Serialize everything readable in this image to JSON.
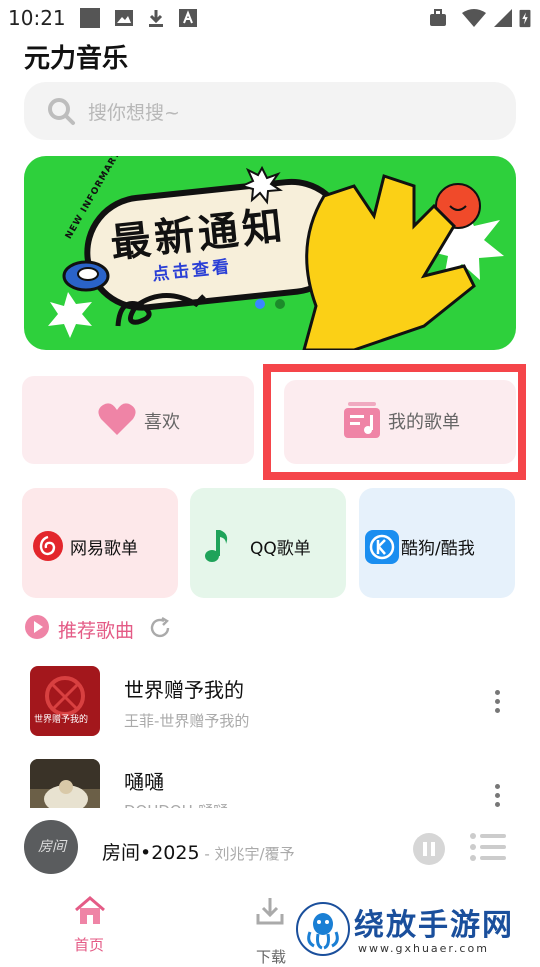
{
  "status_bar": {
    "time": "10:21"
  },
  "app_title": "元力音乐",
  "search": {
    "placeholder": "搜你想搜~"
  },
  "banner": {
    "tag": "NEW INFORMARTION",
    "heading": "最新通知",
    "subheading": "点击查看"
  },
  "quick_cards": {
    "favorites_label": "喜欢",
    "playlists_label": "我的歌单"
  },
  "sources": [
    {
      "label": "网易歌单"
    },
    {
      "label": "QQ歌单"
    },
    {
      "label": "酷狗/酷我"
    }
  ],
  "recommended": {
    "title": "推荐歌曲",
    "songs": [
      {
        "title": "世界赠予我的",
        "subtitle": "王菲-世界赠予我的",
        "cover_text": "世界赠予我的"
      },
      {
        "title": "嗵嗵",
        "subtitle": "DOUDOU-嗵嗵"
      }
    ]
  },
  "now_playing": {
    "title": "房间•2025",
    "artist": " - 刘兆宇/覆予",
    "cover_text": "房间"
  },
  "bottom_nav": {
    "home_label": "首页",
    "download_label": "下载"
  },
  "watermark": {
    "text": "绕放手游网",
    "url": "www.gxhuaer.com"
  },
  "colors": {
    "accent": "#e45b86",
    "highlight": "#f5454a",
    "banner": "#2ed03c"
  }
}
